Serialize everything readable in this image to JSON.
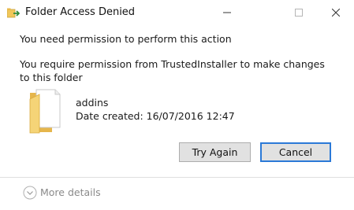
{
  "window": {
    "title": "Folder Access Denied",
    "app_icon": "folder-move-icon"
  },
  "dialog": {
    "heading": "You need permission to perform this action",
    "message": "You require permission from TrustedInstaller to make changes to this folder",
    "item": {
      "icon": "folder-icon",
      "name": "addins",
      "date_created": "Date created: 16/07/2016 12:47"
    }
  },
  "buttons": {
    "try_again": "Try Again",
    "cancel": "Cancel"
  },
  "footer": {
    "more_details": "More details"
  },
  "colors": {
    "focus_border": "#2b79d7",
    "button_face": "#e1e1e1",
    "folder_yellow": "#f3cf65",
    "muted_text": "#8a8a8a"
  }
}
